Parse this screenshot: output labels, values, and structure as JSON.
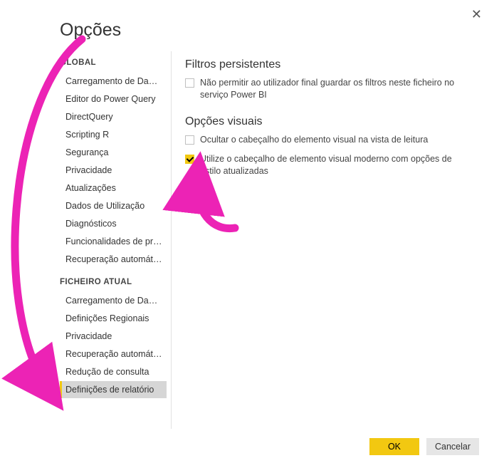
{
  "dialog": {
    "title": "Opções",
    "close_glyph": "✕"
  },
  "sidebar": {
    "section_global": "GLOBAL",
    "global_items": [
      "Carregamento de Dados",
      "Editor do Power Query",
      "DirectQuery",
      "Scripting R",
      "Segurança",
      "Privacidade",
      "Atualizações",
      "Dados de Utilização",
      "Diagnósticos",
      "Funcionalidades de pré…",
      "Recuperação automática"
    ],
    "section_file": "FICHEIRO ATUAL",
    "file_items": [
      "Carregamento de Dados",
      "Definições Regionais",
      "Privacidade",
      "Recuperação automática",
      "Redução de consulta",
      "Definições de relatório"
    ],
    "selected_index": 5
  },
  "content": {
    "group1_title": "Filtros persistentes",
    "cb1_label": "Não permitir ao utilizador final guardar os filtros neste ficheiro no serviço Power BI",
    "cb1_checked": false,
    "group2_title": "Opções visuais",
    "cb2_label": "Ocultar o cabeçalho do elemento visual na vista de leitura",
    "cb2_checked": false,
    "cb3_label": "Utilize o cabeçalho de elemento visual moderno com opções de estilo atualizadas",
    "cb3_checked": true
  },
  "footer": {
    "ok": "OK",
    "cancel": "Cancelar"
  },
  "colors": {
    "accent": "#f2c811",
    "annotation": "#ec23b5"
  }
}
